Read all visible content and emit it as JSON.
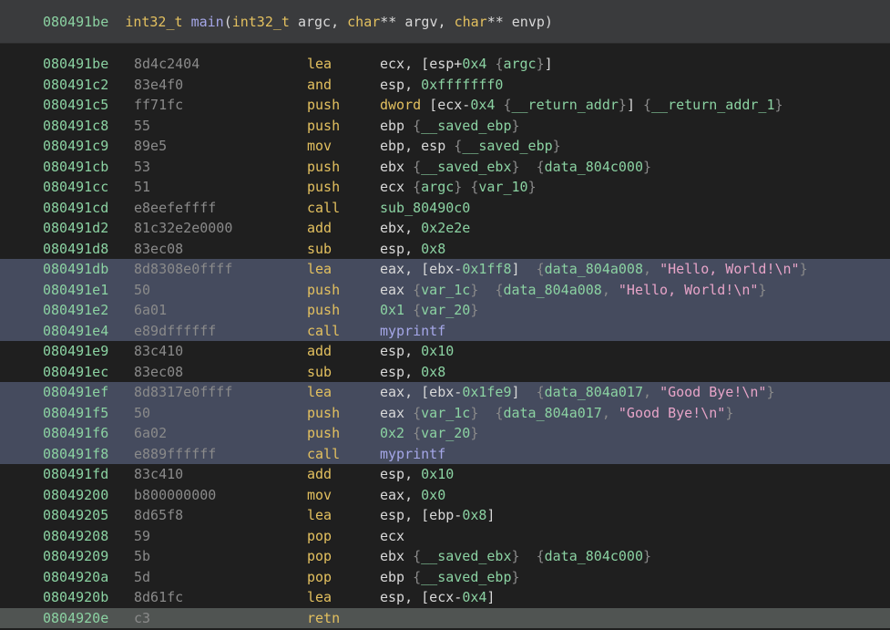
{
  "header": {
    "tokens": [
      {
        "t": "addr",
        "v": "080491be"
      },
      {
        "t": "txt",
        "v": "  "
      },
      {
        "t": "type",
        "v": "int32_t"
      },
      {
        "t": "txt",
        "v": " "
      },
      {
        "t": "func",
        "v": "main"
      },
      {
        "t": "txt",
        "v": "("
      },
      {
        "t": "type",
        "v": "int32_t"
      },
      {
        "t": "txt",
        "v": " argc, "
      },
      {
        "t": "type",
        "v": "char"
      },
      {
        "t": "txt",
        "v": "** argv, "
      },
      {
        "t": "type",
        "v": "char"
      },
      {
        "t": "txt",
        "v": "** envp)"
      }
    ]
  },
  "rows": [
    {
      "addr": "080491be",
      "bytes": "8d4c2404",
      "mn": "lea",
      "hl": "",
      "ops": [
        {
          "t": "reg",
          "v": "ecx, ["
        },
        {
          "t": "reg",
          "v": "esp"
        },
        {
          "t": "txt",
          "v": "+"
        },
        {
          "t": "num",
          "v": "0x4"
        },
        {
          "t": "txt",
          "v": " "
        },
        {
          "t": "brace",
          "v": "{"
        },
        {
          "t": "var",
          "v": "argc"
        },
        {
          "t": "brace",
          "v": "}"
        },
        {
          "t": "txt",
          "v": "]"
        }
      ]
    },
    {
      "addr": "080491c2",
      "bytes": "83e4f0",
      "mn": "and",
      "hl": "",
      "ops": [
        {
          "t": "reg",
          "v": "esp, "
        },
        {
          "t": "num",
          "v": "0xfffffff0"
        }
      ]
    },
    {
      "addr": "080491c5",
      "bytes": "ff71fc",
      "mn": "push",
      "hl": "",
      "ops": [
        {
          "t": "kw",
          "v": "dword"
        },
        {
          "t": "txt",
          "v": " [ecx-"
        },
        {
          "t": "num",
          "v": "0x4"
        },
        {
          "t": "txt",
          "v": " "
        },
        {
          "t": "brace",
          "v": "{"
        },
        {
          "t": "var",
          "v": "__return_addr"
        },
        {
          "t": "brace",
          "v": "}"
        },
        {
          "t": "txt",
          "v": "] "
        },
        {
          "t": "brace",
          "v": "{"
        },
        {
          "t": "var",
          "v": "__return_addr_1"
        },
        {
          "t": "brace",
          "v": "}"
        }
      ]
    },
    {
      "addr": "080491c8",
      "bytes": "55",
      "mn": "push",
      "hl": "",
      "ops": [
        {
          "t": "reg",
          "v": "ebp "
        },
        {
          "t": "brace",
          "v": "{"
        },
        {
          "t": "var",
          "v": "__saved_ebp"
        },
        {
          "t": "brace",
          "v": "}"
        }
      ]
    },
    {
      "addr": "080491c9",
      "bytes": "89e5",
      "mn": "mov",
      "hl": "",
      "ops": [
        {
          "t": "reg",
          "v": "ebp, esp "
        },
        {
          "t": "brace",
          "v": "{"
        },
        {
          "t": "var",
          "v": "__saved_ebp"
        },
        {
          "t": "brace",
          "v": "}"
        }
      ]
    },
    {
      "addr": "080491cb",
      "bytes": "53",
      "mn": "push",
      "hl": "",
      "ops": [
        {
          "t": "reg",
          "v": "ebx "
        },
        {
          "t": "brace",
          "v": "{"
        },
        {
          "t": "var",
          "v": "__saved_ebx"
        },
        {
          "t": "brace",
          "v": "}"
        },
        {
          "t": "txt",
          "v": "  "
        },
        {
          "t": "brace",
          "v": "{"
        },
        {
          "t": "sym",
          "v": "data_804c000"
        },
        {
          "t": "brace",
          "v": "}"
        }
      ]
    },
    {
      "addr": "080491cc",
      "bytes": "51",
      "mn": "push",
      "hl": "",
      "ops": [
        {
          "t": "reg",
          "v": "ecx "
        },
        {
          "t": "brace",
          "v": "{"
        },
        {
          "t": "var",
          "v": "argc"
        },
        {
          "t": "brace",
          "v": "}"
        },
        {
          "t": "txt",
          "v": " "
        },
        {
          "t": "brace",
          "v": "{"
        },
        {
          "t": "var",
          "v": "var_10"
        },
        {
          "t": "brace",
          "v": "}"
        }
      ]
    },
    {
      "addr": "080491cd",
      "bytes": "e8eefeffff",
      "mn": "call",
      "hl": "",
      "ops": [
        {
          "t": "sym",
          "v": "sub_80490c0"
        }
      ]
    },
    {
      "addr": "080491d2",
      "bytes": "81c32e2e0000",
      "mn": "add",
      "hl": "",
      "ops": [
        {
          "t": "reg",
          "v": "ebx, "
        },
        {
          "t": "num",
          "v": "0x2e2e"
        }
      ]
    },
    {
      "addr": "080491d8",
      "bytes": "83ec08",
      "mn": "sub",
      "hl": "",
      "ops": [
        {
          "t": "reg",
          "v": "esp, "
        },
        {
          "t": "num",
          "v": "0x8"
        }
      ]
    },
    {
      "addr": "080491db",
      "bytes": "8d8308e0ffff",
      "mn": "lea",
      "hl": "sel",
      "ops": [
        {
          "t": "reg",
          "v": "eax, [ebx-"
        },
        {
          "t": "num",
          "v": "0x1ff8"
        },
        {
          "t": "txt",
          "v": "]  "
        },
        {
          "t": "brace",
          "v": "{"
        },
        {
          "t": "sym",
          "v": "data_804a008"
        },
        {
          "t": "punct",
          "v": ", "
        },
        {
          "t": "str",
          "v": "\"Hello, World!\\n\""
        },
        {
          "t": "brace",
          "v": "}"
        }
      ]
    },
    {
      "addr": "080491e1",
      "bytes": "50",
      "mn": "push",
      "hl": "sel",
      "ops": [
        {
          "t": "reg",
          "v": "eax "
        },
        {
          "t": "brace",
          "v": "{"
        },
        {
          "t": "var",
          "v": "var_1c"
        },
        {
          "t": "brace",
          "v": "}"
        },
        {
          "t": "txt",
          "v": "  "
        },
        {
          "t": "brace",
          "v": "{"
        },
        {
          "t": "sym",
          "v": "data_804a008"
        },
        {
          "t": "punct",
          "v": ", "
        },
        {
          "t": "str",
          "v": "\"Hello, World!\\n\""
        },
        {
          "t": "brace",
          "v": "}"
        }
      ]
    },
    {
      "addr": "080491e2",
      "bytes": "6a01",
      "mn": "push",
      "hl": "sel",
      "ops": [
        {
          "t": "num",
          "v": "0x1"
        },
        {
          "t": "txt",
          "v": " "
        },
        {
          "t": "brace",
          "v": "{"
        },
        {
          "t": "var",
          "v": "var_20"
        },
        {
          "t": "brace",
          "v": "}"
        }
      ]
    },
    {
      "addr": "080491e4",
      "bytes": "e89dffffff",
      "mn": "call",
      "hl": "sel",
      "ops": [
        {
          "t": "func",
          "v": "myprintf"
        }
      ]
    },
    {
      "addr": "080491e9",
      "bytes": "83c410",
      "mn": "add",
      "hl": "",
      "ops": [
        {
          "t": "reg",
          "v": "esp, "
        },
        {
          "t": "num",
          "v": "0x10"
        }
      ]
    },
    {
      "addr": "080491ec",
      "bytes": "83ec08",
      "mn": "sub",
      "hl": "",
      "ops": [
        {
          "t": "reg",
          "v": "esp, "
        },
        {
          "t": "num",
          "v": "0x8"
        }
      ]
    },
    {
      "addr": "080491ef",
      "bytes": "8d8317e0ffff",
      "mn": "lea",
      "hl": "sel",
      "ops": [
        {
          "t": "reg",
          "v": "eax, [ebx-"
        },
        {
          "t": "num",
          "v": "0x1fe9"
        },
        {
          "t": "txt",
          "v": "]  "
        },
        {
          "t": "brace",
          "v": "{"
        },
        {
          "t": "sym",
          "v": "data_804a017"
        },
        {
          "t": "punct",
          "v": ", "
        },
        {
          "t": "str",
          "v": "\"Good Bye!\\n\""
        },
        {
          "t": "brace",
          "v": "}"
        }
      ]
    },
    {
      "addr": "080491f5",
      "bytes": "50",
      "mn": "push",
      "hl": "sel",
      "ops": [
        {
          "t": "reg",
          "v": "eax "
        },
        {
          "t": "brace",
          "v": "{"
        },
        {
          "t": "var",
          "v": "var_1c"
        },
        {
          "t": "brace",
          "v": "}"
        },
        {
          "t": "txt",
          "v": "  "
        },
        {
          "t": "brace",
          "v": "{"
        },
        {
          "t": "sym",
          "v": "data_804a017"
        },
        {
          "t": "punct",
          "v": ", "
        },
        {
          "t": "str",
          "v": "\"Good Bye!\\n\""
        },
        {
          "t": "brace",
          "v": "}"
        }
      ]
    },
    {
      "addr": "080491f6",
      "bytes": "6a02",
      "mn": "push",
      "hl": "sel",
      "ops": [
        {
          "t": "num",
          "v": "0x2"
        },
        {
          "t": "txt",
          "v": " "
        },
        {
          "t": "brace",
          "v": "{"
        },
        {
          "t": "var",
          "v": "var_20"
        },
        {
          "t": "brace",
          "v": "}"
        }
      ]
    },
    {
      "addr": "080491f8",
      "bytes": "e889ffffff",
      "mn": "call",
      "hl": "sel",
      "ops": [
        {
          "t": "func",
          "v": "myprintf"
        }
      ]
    },
    {
      "addr": "080491fd",
      "bytes": "83c410",
      "mn": "add",
      "hl": "",
      "ops": [
        {
          "t": "reg",
          "v": "esp, "
        },
        {
          "t": "num",
          "v": "0x10"
        }
      ]
    },
    {
      "addr": "08049200",
      "bytes": "b800000000",
      "mn": "mov",
      "hl": "",
      "ops": [
        {
          "t": "reg",
          "v": "eax, "
        },
        {
          "t": "num",
          "v": "0x0"
        }
      ]
    },
    {
      "addr": "08049205",
      "bytes": "8d65f8",
      "mn": "lea",
      "hl": "",
      "ops": [
        {
          "t": "reg",
          "v": "esp, [ebp-"
        },
        {
          "t": "num",
          "v": "0x8"
        },
        {
          "t": "txt",
          "v": "]"
        }
      ]
    },
    {
      "addr": "08049208",
      "bytes": "59",
      "mn": "pop",
      "hl": "",
      "ops": [
        {
          "t": "reg",
          "v": "ecx"
        }
      ]
    },
    {
      "addr": "08049209",
      "bytes": "5b",
      "mn": "pop",
      "hl": "",
      "ops": [
        {
          "t": "reg",
          "v": "ebx "
        },
        {
          "t": "brace",
          "v": "{"
        },
        {
          "t": "var",
          "v": "__saved_ebx"
        },
        {
          "t": "brace",
          "v": "}"
        },
        {
          "t": "txt",
          "v": "  "
        },
        {
          "t": "brace",
          "v": "{"
        },
        {
          "t": "sym",
          "v": "data_804c000"
        },
        {
          "t": "brace",
          "v": "}"
        }
      ]
    },
    {
      "addr": "0804920a",
      "bytes": "5d",
      "mn": "pop",
      "hl": "",
      "ops": [
        {
          "t": "reg",
          "v": "ebp "
        },
        {
          "t": "brace",
          "v": "{"
        },
        {
          "t": "var",
          "v": "__saved_ebp"
        },
        {
          "t": "brace",
          "v": "}"
        }
      ]
    },
    {
      "addr": "0804920b",
      "bytes": "8d61fc",
      "mn": "lea",
      "hl": "",
      "ops": [
        {
          "t": "reg",
          "v": "esp, [ecx-"
        },
        {
          "t": "num",
          "v": "0x4"
        },
        {
          "t": "txt",
          "v": "]"
        }
      ]
    },
    {
      "addr": "0804920e",
      "bytes": "c3",
      "mn": "retn",
      "hl": "cur",
      "ops": []
    }
  ]
}
